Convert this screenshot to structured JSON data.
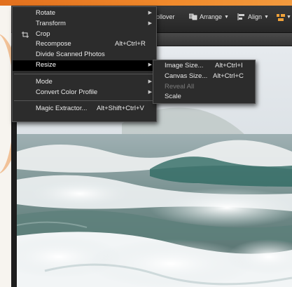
{
  "toolbar": {
    "rollover_label": "n Rollover",
    "arrange_label": "Arrange",
    "align_label": "Align",
    "arrange_icon": "arrange-icon",
    "align_icon": "align-icon",
    "distribute_icon": "distribute-icon"
  },
  "image_menu": {
    "items": [
      {
        "label": "Rotate",
        "shortcut": "",
        "has_submenu": true
      },
      {
        "label": "Transform",
        "shortcut": "",
        "has_submenu": true
      },
      {
        "label": "Crop",
        "shortcut": "",
        "has_submenu": false,
        "icon": "crop-icon"
      },
      {
        "label": "Recompose",
        "shortcut": "Alt+Ctrl+R",
        "has_submenu": false
      },
      {
        "label": "Divide Scanned Photos",
        "shortcut": "",
        "has_submenu": false
      },
      {
        "label": "Resize",
        "shortcut": "",
        "has_submenu": true,
        "selected": true
      },
      {
        "label": "Mode",
        "shortcut": "",
        "has_submenu": true
      },
      {
        "label": "Convert Color Profile",
        "shortcut": "",
        "has_submenu": true
      },
      {
        "label": "Magic Extractor...",
        "shortcut": "Alt+Shift+Ctrl+V",
        "has_submenu": false
      }
    ]
  },
  "resize_submenu": {
    "items": [
      {
        "label": "Image Size...",
        "shortcut": "Alt+Ctrl+I",
        "disabled": false
      },
      {
        "label": "Canvas Size...",
        "shortcut": "Alt+Ctrl+C",
        "disabled": false
      },
      {
        "label": "Reveal All",
        "shortcut": "",
        "disabled": true
      },
      {
        "label": "Scale",
        "shortcut": "",
        "disabled": false
      }
    ]
  },
  "colors": {
    "accent_orange": "#f08a2c",
    "menu_bg": "#2c2c2c",
    "menu_selected": "#000000"
  }
}
